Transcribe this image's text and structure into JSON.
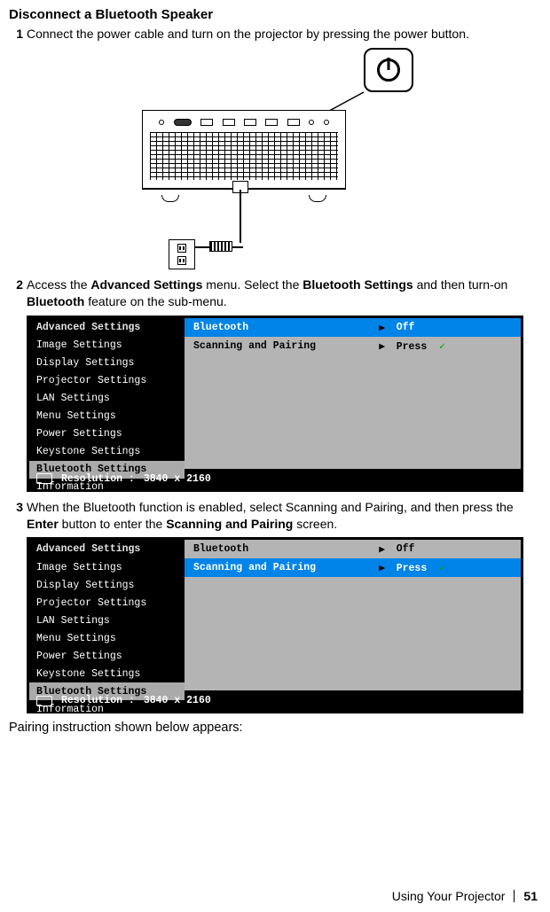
{
  "title": "Disconnect a Bluetooth Speaker",
  "steps": {
    "s1_num": "1",
    "s1_pre": "Connect the power cable and turn on the projector by pressing the power button.",
    "s2_num": "2",
    "s2_pre": "Access the ",
    "s2_b1": "Advanced Settings",
    "s2_mid1": " menu. Select the ",
    "s2_b2": "Bluetooth Settings",
    "s2_mid2": " and then turn-on ",
    "s2_b3": "Bluetooth",
    "s2_post": " feature on the sub-menu.",
    "s3_num": "3",
    "s3_pre": "When the Bluetooth function is enabled, select Scanning and Pairing, and then press the ",
    "s3_b1": "Enter",
    "s3_mid1": " button to enter the ",
    "s3_b2": "Scanning and Pairing",
    "s3_post": " screen."
  },
  "osd1": {
    "title": "Advanced Settings",
    "left": [
      "Image Settings",
      "Display Settings",
      "Projector Settings",
      "LAN Settings",
      "Menu Settings",
      "Power Settings",
      "Keystone Settings",
      "Bluetooth Settings",
      "Information"
    ],
    "selected_index": 7,
    "right": [
      {
        "label": "Bluetooth",
        "value": "Off",
        "highlight": true
      },
      {
        "label": "Scanning and Pairing",
        "value": "Press",
        "check": true,
        "highlight": false
      }
    ],
    "resolution_label": "Resolution :",
    "resolution_value": "3840 x 2160"
  },
  "osd2": {
    "title": "Advanced Settings",
    "left": [
      "Image Settings",
      "Display Settings",
      "Projector Settings",
      "LAN Settings",
      "Menu Settings",
      "Power Settings",
      "Keystone Settings",
      "Bluetooth Settings",
      "Information"
    ],
    "selected_index": 7,
    "right": [
      {
        "label": "Bluetooth",
        "value": "Off",
        "highlight": false
      },
      {
        "label": "Scanning and Pairing",
        "value": "Press",
        "check": true,
        "highlight": true
      }
    ],
    "resolution_label": "Resolution :",
    "resolution_value": "3840 x 2160"
  },
  "pairing_text": "Pairing instruction shown below appears:",
  "footer": {
    "section": "Using Your Projector",
    "page": "51"
  }
}
